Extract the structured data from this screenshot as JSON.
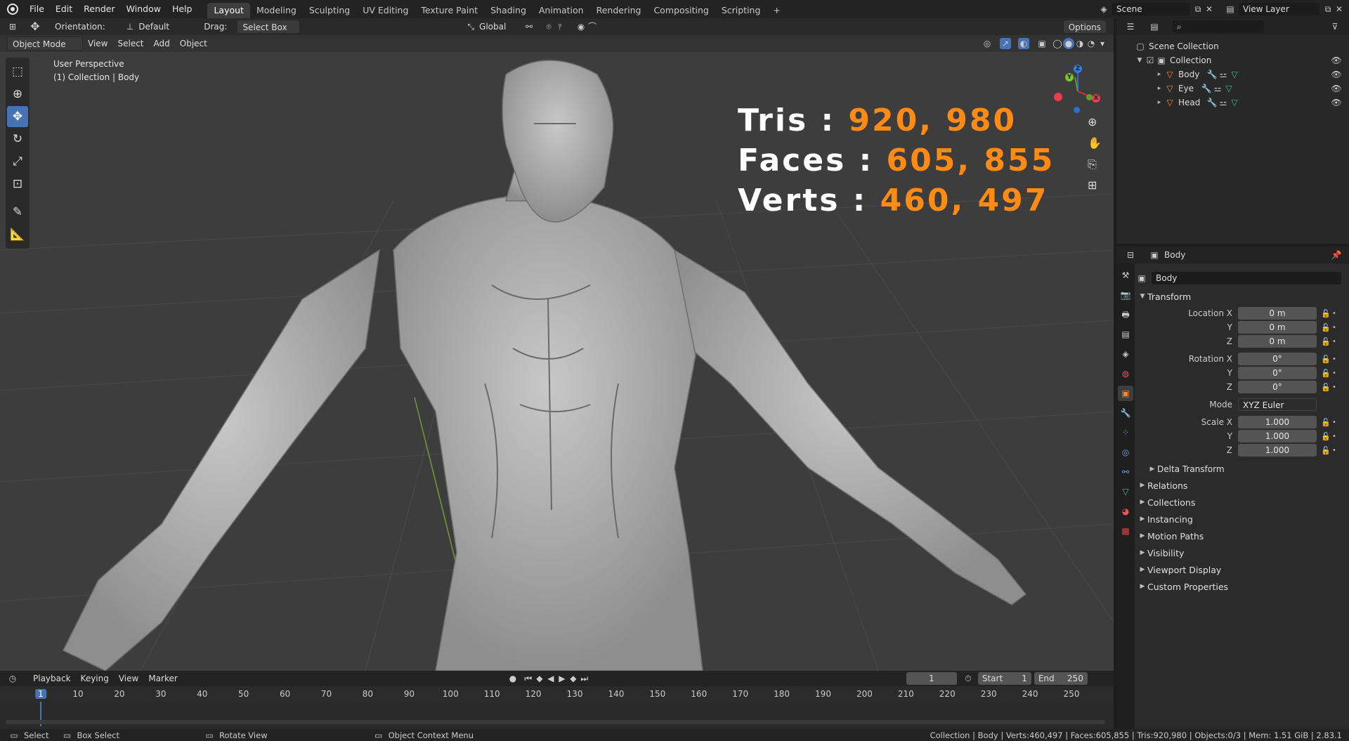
{
  "topbar": {
    "menus": [
      "File",
      "Edit",
      "Render",
      "Window",
      "Help"
    ],
    "workspaces": [
      "Layout",
      "Modeling",
      "Sculpting",
      "UV Editing",
      "Texture Paint",
      "Shading",
      "Animation",
      "Rendering",
      "Compositing",
      "Scripting"
    ],
    "active_workspace": "Layout",
    "add_workspace": "+",
    "scene_name": "Scene",
    "view_layer": "View Layer"
  },
  "tool_header": {
    "orientation_label": "Orientation:",
    "orientation_value": "Default",
    "drag_label": "Drag:",
    "drag_value": "Select Box",
    "transform_orientation": "Global",
    "options_label": "Options"
  },
  "view_header": {
    "mode": "Object Mode",
    "menus": [
      "View",
      "Select",
      "Add",
      "Object"
    ]
  },
  "viewport": {
    "perspective": "User Perspective",
    "collection_info": "(1) Collection | Body",
    "stats": [
      {
        "label": "Tris : ",
        "value": "920, 980"
      },
      {
        "label": "Faces : ",
        "value": "605, 855"
      },
      {
        "label": "Verts : ",
        "value": "460, 497"
      }
    ],
    "gizmo": {
      "x": "X",
      "y": "Y",
      "z": "Z"
    },
    "subject": "sculpted humanoid body mesh"
  },
  "toolbar_tools": [
    "select-box-tool",
    "cursor-tool",
    "move-tool",
    "rotate-tool",
    "scale-tool",
    "transform-tool",
    "annotate-tool",
    "measure-tool"
  ],
  "active_tool": "move-tool",
  "timeline": {
    "menus": [
      "Playback",
      "Keying",
      "View",
      "Marker"
    ],
    "current_frame": "1",
    "start_label": "Start",
    "start_value": "1",
    "end_label": "End",
    "end_value": "250",
    "ticks": [
      "1",
      "10",
      "20",
      "30",
      "40",
      "50",
      "60",
      "70",
      "80",
      "90",
      "100",
      "110",
      "120",
      "130",
      "140",
      "150",
      "160",
      "170",
      "180",
      "190",
      "200",
      "210",
      "220",
      "230",
      "240",
      "250"
    ]
  },
  "outliner": {
    "search_placeholder": "",
    "scene_collection": "Scene Collection",
    "collection": "Collection",
    "objects": [
      "Body",
      "Eye",
      "Head"
    ]
  },
  "properties": {
    "header_object": "Body",
    "object_name": "Body",
    "transform_label": "Transform",
    "location_label": "Location X",
    "rotation_label": "Rotation X",
    "scale_label": "Scale X",
    "y_label": "Y",
    "z_label": "Z",
    "location": [
      "0 m",
      "0 m",
      "0 m"
    ],
    "rotation": [
      "0°",
      "0°",
      "0°"
    ],
    "mode_label": "Mode",
    "mode_value": "XYZ Euler",
    "scale": [
      "1.000",
      "1.000",
      "1.000"
    ],
    "delta_transform": "Delta Transform",
    "sections": [
      "Relations",
      "Collections",
      "Instancing",
      "Motion Paths",
      "Visibility",
      "Viewport Display",
      "Custom Properties"
    ]
  },
  "statusbar": {
    "select": "Select",
    "box_select": "Box Select",
    "rotate_view": "Rotate View",
    "context_menu": "Object Context Menu",
    "info": "Collection | Body | Verts:460,497 | Faces:605,855 | Tris:920,980 | Objects:0/3 | Mem: 1.51 GiB | 2.83.1"
  },
  "colors": {
    "accent": "#4772b3",
    "stat_value": "#ff8a14",
    "viewport_bg": "#3d3d3d"
  }
}
